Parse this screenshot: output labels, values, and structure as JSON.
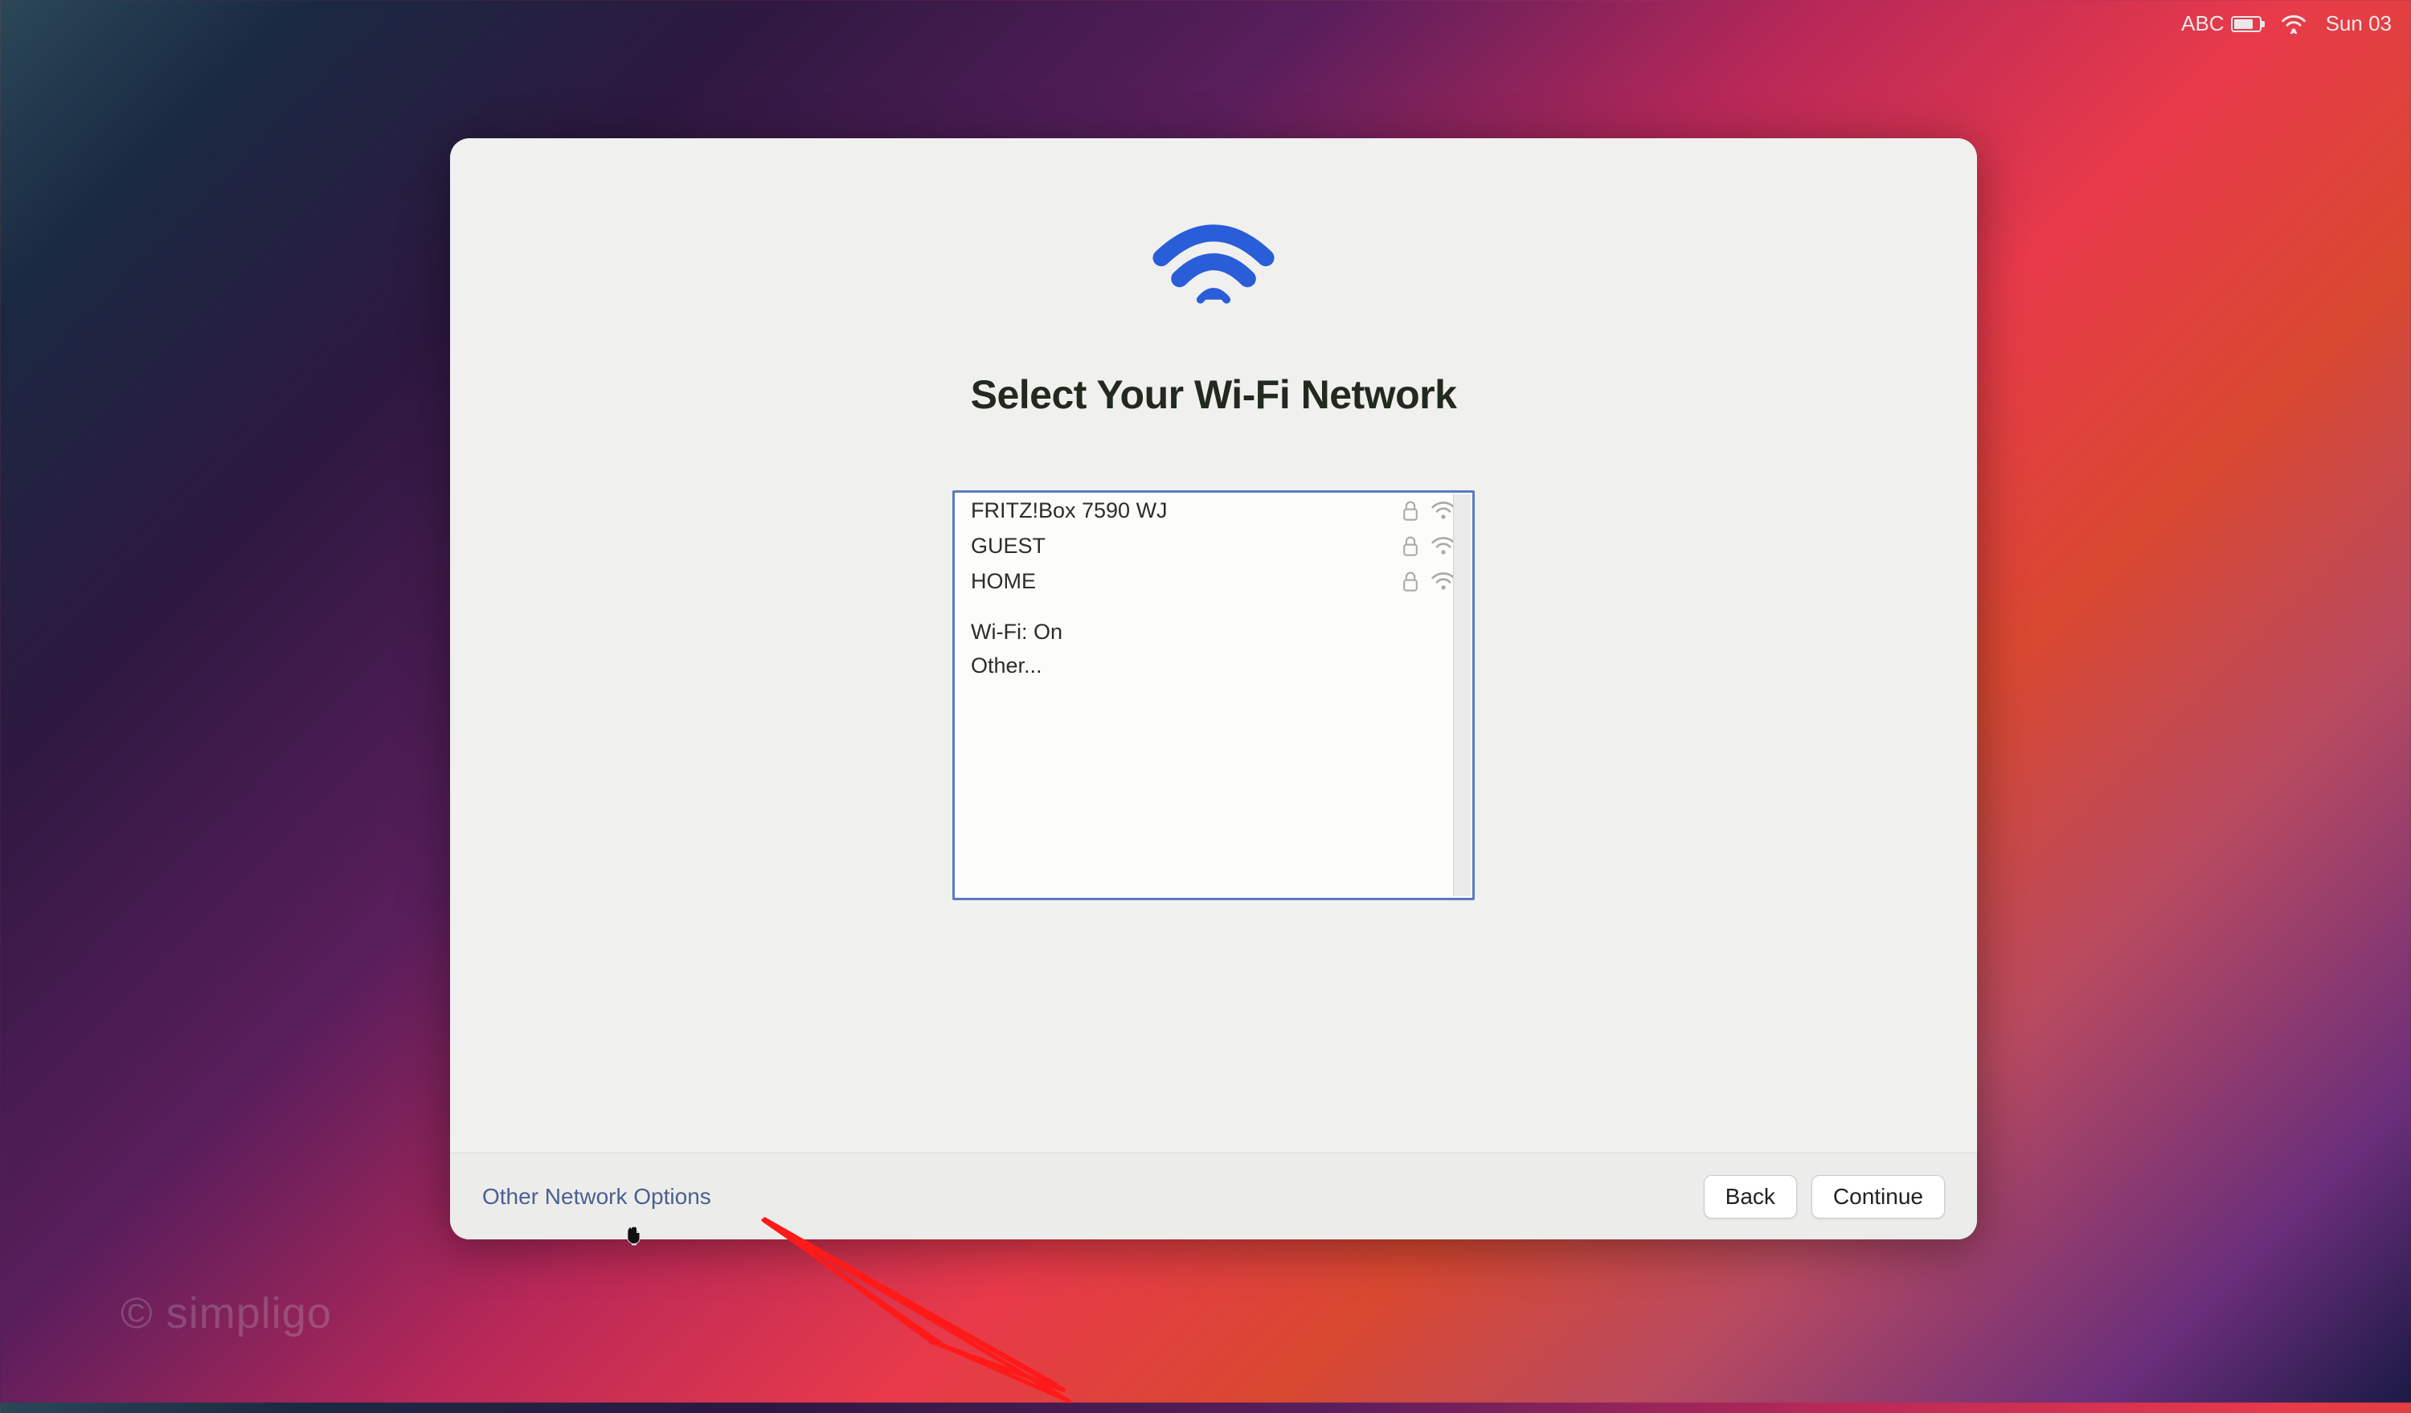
{
  "menubar": {
    "input_method": "ABC",
    "clock": "Sun 03"
  },
  "panel": {
    "title": "Select Your Wi-Fi Network",
    "networks": [
      {
        "name": "FRITZ!Box 7590 WJ",
        "locked": true
      },
      {
        "name": "GUEST",
        "locked": true
      },
      {
        "name": "HOME",
        "locked": true
      }
    ],
    "status_label": "Wi-Fi: On",
    "other_label": "Other...",
    "footer": {
      "other_options": "Other Network Options",
      "back": "Back",
      "continue": "Continue"
    }
  },
  "watermark": "© simpligo"
}
